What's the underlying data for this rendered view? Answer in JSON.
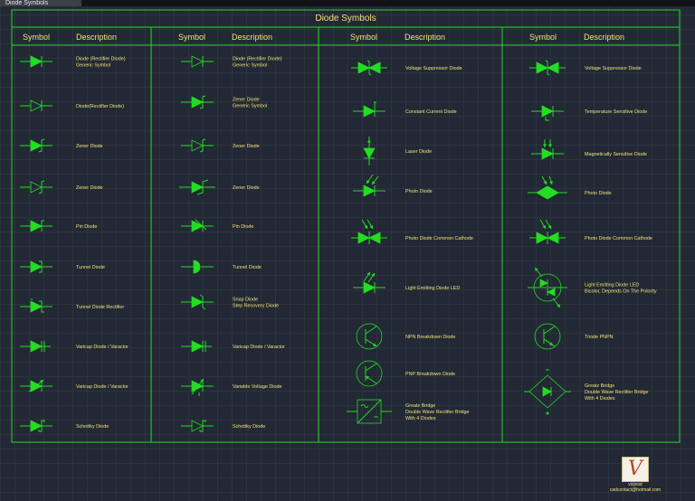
{
  "window": {
    "title": "Diode Symbols"
  },
  "sheet": {
    "title": "Diode Symbols"
  },
  "columns": [
    {
      "symbol_header": "Symbol",
      "description_header": "Description"
    },
    {
      "symbol_header": "Symbol",
      "description_header": "Description"
    },
    {
      "symbol_header": "Symbol",
      "description_header": "Description"
    },
    {
      "symbol_header": "Symbol",
      "description_header": "Description"
    }
  ],
  "entries": [
    [
      {
        "lines": [
          "Diode (Rectifier Diode)",
          "Generic Symbol"
        ],
        "symbol": "diode-filled-icon"
      },
      {
        "lines": [
          "Diode(Rectifier Diode)"
        ],
        "symbol": "diode-outline-icon"
      },
      {
        "lines": [
          "Zener Diode"
        ],
        "symbol": "zener-diode-filled-icon"
      },
      {
        "lines": [
          "Zener Diode"
        ],
        "symbol": "zener-diode-outline-icon"
      },
      {
        "lines": [
          "Pin Diode"
        ],
        "symbol": "pin-diode-icon"
      },
      {
        "lines": [
          "Tunnel Diode"
        ],
        "symbol": "tunnel-diode-icon"
      },
      {
        "lines": [
          "Tunnel Diode Rectifier"
        ],
        "symbol": "tunnel-rectifier-icon"
      },
      {
        "lines": [
          "Varicap Diode / Varactor"
        ],
        "symbol": "varicap-diode-icon"
      },
      {
        "lines": [
          "Varicap Diode / Varactor"
        ],
        "symbol": "varactor-arrow-icon"
      },
      {
        "lines": [
          "Schottky Diode"
        ],
        "symbol": "schottky-diode-icon"
      }
    ],
    [
      {
        "lines": [
          "Diode (Rectifier Diode)",
          "Generic Symbol"
        ],
        "symbol": "diode-outline-icon"
      },
      {
        "lines": [
          "Zener Diode",
          "Generic Symbol"
        ],
        "symbol": "zener-diode-filled-icon"
      },
      {
        "lines": [
          "Zener Diode"
        ],
        "symbol": "zener-diode-outline-icon"
      },
      {
        "lines": [
          "Zener Diode"
        ],
        "symbol": "zener-diode-wide-icon"
      },
      {
        "lines": [
          "Pin Diode"
        ],
        "symbol": "pin-diode-slash-icon"
      },
      {
        "lines": [
          "Tunnel Diode"
        ],
        "symbol": "tunnel-half-icon"
      },
      {
        "lines": [
          "Snap Diode",
          "Step Recovery Diode"
        ],
        "symbol": "snap-diode-icon"
      },
      {
        "lines": [
          "Varicap Diode / Varactor"
        ],
        "symbol": "varicap-diode-icon"
      },
      {
        "lines": [
          "Variable Voltage Diode"
        ],
        "symbol": "variable-voltage-icon"
      },
      {
        "lines": [
          "Schottky Diode"
        ],
        "symbol": "schottky-outline-icon"
      }
    ],
    [
      {
        "lines": [
          "Voltage Suppressor Diode"
        ],
        "symbol": "voltage-suppressor-icon"
      },
      {
        "lines": [
          "Constant Current Diode"
        ],
        "symbol": "constant-current-icon"
      },
      {
        "lines": [
          "Laser Diode"
        ],
        "symbol": "laser-diode-icon"
      },
      {
        "lines": [
          "Photo Diode"
        ],
        "symbol": "photo-diode-icon"
      },
      {
        "lines": [
          "Photo Diode Common Cathode"
        ],
        "symbol": "photo-common-cathode-icon"
      },
      {
        "lines": [
          "Light Emitting Diode LED"
        ],
        "symbol": "led-icon"
      },
      {
        "lines": [
          "NPN Breakdown Diode"
        ],
        "symbol": "npn-breakdown-icon"
      },
      {
        "lines": [
          "PNP Breakdown Diode"
        ],
        "symbol": "pnp-breakdown-icon"
      },
      {
        "lines": [
          "Greatz Bridge",
          "Double Wave Rectifier Bridge",
          "With 4 Diodes"
        ],
        "symbol": "bridge-box-icon"
      }
    ],
    [
      {
        "lines": [
          "Voltage Suppressor Diode"
        ],
        "symbol": "voltage-suppressor-icon"
      },
      {
        "lines": [
          "Temperature Sensitive Diode"
        ],
        "symbol": "temperature-sensitive-icon"
      },
      {
        "lines": [
          "Magnetically Sensitive Diode"
        ],
        "symbol": "magnetic-sensitive-icon"
      },
      {
        "lines": [
          "Photo Diode"
        ],
        "symbol": "photo-diode-diamond-icon"
      },
      {
        "lines": [
          "Photo Diode Common Cathode"
        ],
        "symbol": "photo-common-cathode-icon"
      },
      {
        "lines": [
          "Light Emitting Diode LED",
          "Bicolor, Depends On The Polority"
        ],
        "symbol": "bicolor-led-icon"
      },
      {
        "lines": [
          "Triode PNPN"
        ],
        "symbol": "triode-pnpn-icon"
      },
      {
        "lines": [
          "Greatz Bridge",
          "Double Wave Rectifier Bridge",
          "With 4 Diodes"
        ],
        "symbol": "bridge-diamond-icon"
      }
    ]
  ],
  "logo": {
    "line1": "vizpost",
    "line2": "cadcontact@hotmail.com"
  }
}
